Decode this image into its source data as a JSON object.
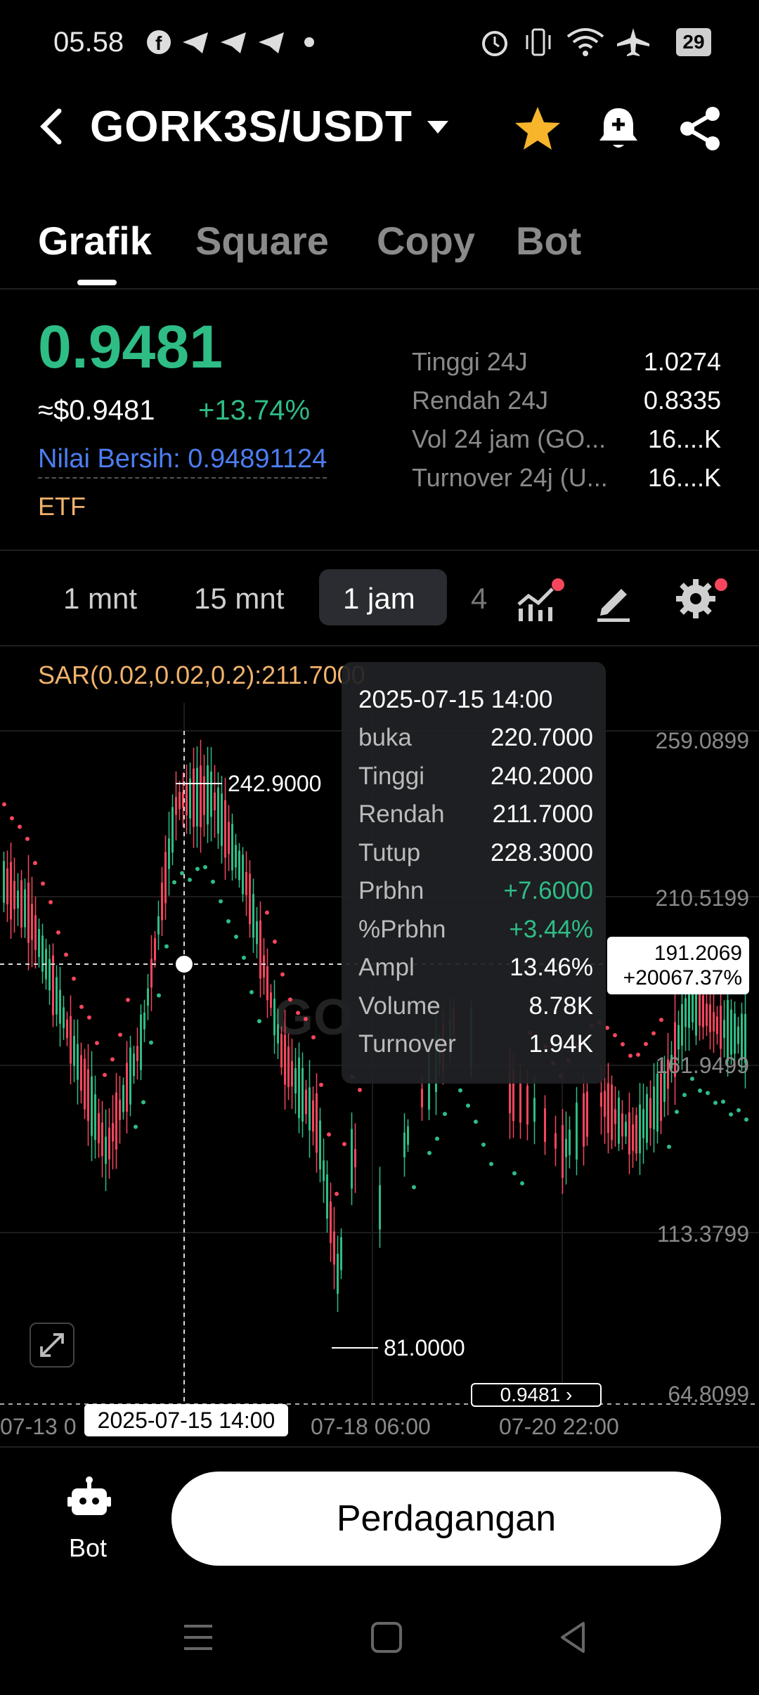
{
  "status": {
    "time": "05.58",
    "battery": "29"
  },
  "header": {
    "pair": "GORK3S/USDT"
  },
  "tabs": [
    {
      "label": "Grafik"
    },
    {
      "label": "Square"
    },
    {
      "label": "Copy"
    },
    {
      "label": "Bot"
    }
  ],
  "price": {
    "last": "0.9481",
    "usd": "≈$0.9481",
    "change": "+13.74%",
    "nav": "Nilai Bersih: 0.94891124",
    "badge": "ETF"
  },
  "stats": [
    {
      "label": "Tinggi 24J",
      "value": "1.0274"
    },
    {
      "label": "Rendah 24J",
      "value": "0.8335"
    },
    {
      "label": "Vol 24 jam (GO...",
      "value": "16....K"
    },
    {
      "label": "Turnover 24j (U...",
      "value": "16....K"
    }
  ],
  "timeframes": {
    "t1": "1 mnt",
    "t2": "15 mnt",
    "t3": "1 jam",
    "t4": "4"
  },
  "chart": {
    "indicator": "SAR(0.02,0.02,0.2):211.7000",
    "high_marker": "242.9000",
    "low_marker": "81.0000",
    "y_ticks": [
      "259.0899",
      "210.5199",
      "161.9499",
      "113.3799",
      "64.8099"
    ],
    "x_ticks": [
      "07-13 0",
      "07-18 06:00",
      "07-20 22:00"
    ],
    "crosshair_date": "2025-07-15 14:00",
    "crosshair_price": "191.2069",
    "crosshair_pct": "+20067.37%",
    "last_price_tag": "0.9481",
    "watermark": "GO"
  },
  "tooltip": {
    "date": "2025-07-15 14:00",
    "rows": [
      {
        "label": "buka",
        "value": "220.7000"
      },
      {
        "label": "Tinggi",
        "value": "240.2000"
      },
      {
        "label": "Rendah",
        "value": "211.7000"
      },
      {
        "label": "Tutup",
        "value": "228.3000"
      },
      {
        "label": "Prbhn",
        "value": "+7.6000"
      },
      {
        "label": "%Prbhn",
        "value": "+3.44%"
      },
      {
        "label": "Ampl",
        "value": "13.46%"
      },
      {
        "label": "Volume",
        "value": "8.78K"
      },
      {
        "label": "Turnover",
        "value": "1.94K"
      }
    ]
  },
  "bottom": {
    "bot_label": "Bot",
    "trade_label": "Perdagangan"
  },
  "colors": {
    "up": "#2ebd85",
    "down": "#f6465d",
    "sar": "#f0b26b",
    "link": "#4c7ef0"
  }
}
